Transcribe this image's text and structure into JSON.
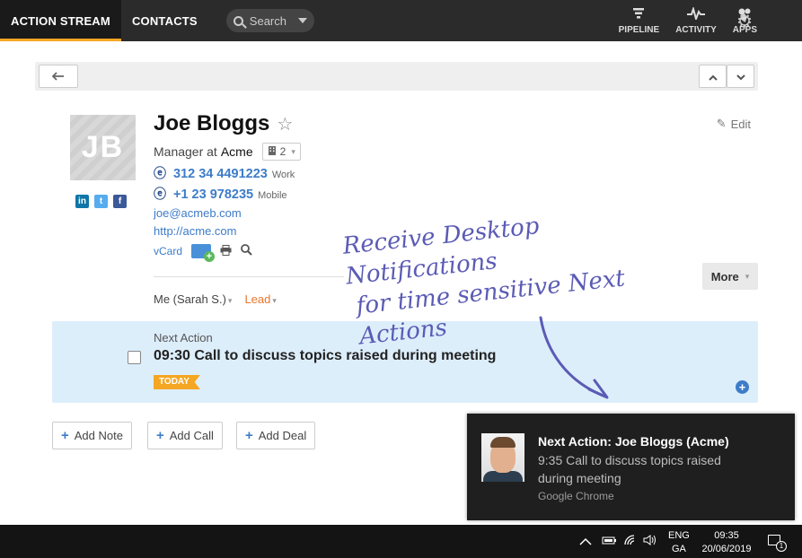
{
  "topnav": {
    "tabs": [
      {
        "label": "ACTION STREAM",
        "active": true
      },
      {
        "label": "CONTACTS",
        "active": false
      }
    ],
    "search": {
      "placeholder": "Search"
    },
    "right_items": [
      {
        "label": "PIPELINE",
        "icon": "funnel-icon"
      },
      {
        "label": "ACTIVITY",
        "icon": "pulse-icon"
      },
      {
        "label": "APPS",
        "icon": "apps-icon"
      }
    ],
    "accent_color": "#f5a623"
  },
  "contact": {
    "initials": "JB",
    "name": "Joe Bloggs",
    "role": "Manager at",
    "organisation": "Acme",
    "org_count": "2",
    "edit_label": "Edit",
    "phones": [
      {
        "number": "312 34 4491223",
        "kind": "Work"
      },
      {
        "number": "+1 23 978235",
        "kind": "Mobile"
      }
    ],
    "email": "joe@acmeb.com",
    "website": "http://acme.com",
    "vcard_label": "vCard",
    "owner": "Me (Sarah S.)",
    "status": "Lead",
    "more_label": "More"
  },
  "next_action": {
    "label": "Next Action",
    "title": "09:30 Call to discuss topics raised during meeting",
    "badge": "TODAY"
  },
  "add_buttons": {
    "note": "Add Note",
    "call": "Add Call",
    "deal": "Add Deal"
  },
  "promo": {
    "line1": "Receive Desktop Notifications",
    "line2": "for time sensitive Next Actions"
  },
  "notification": {
    "title": "Next Action: Joe Bloggs (Acme)",
    "body": "9:35 Call to discuss topics raised during meeting",
    "source": "Google Chrome"
  },
  "taskbar": {
    "lang_top": "ENG",
    "lang_bottom": "GA",
    "time": "09:35",
    "date": "20/06/2019",
    "notif_count": "1"
  }
}
